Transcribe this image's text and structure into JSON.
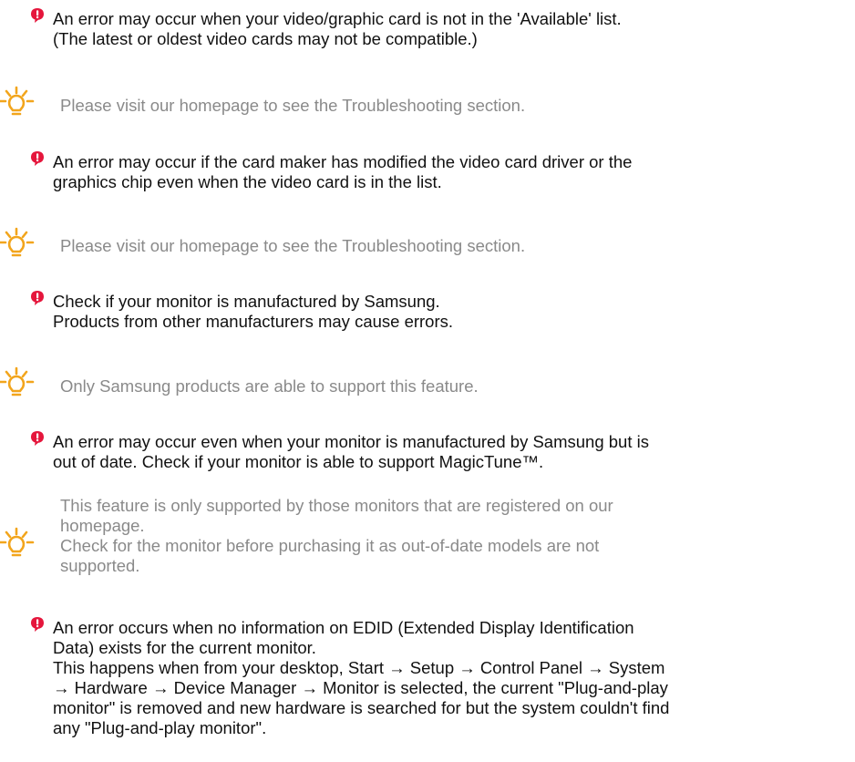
{
  "entries": [
    {
      "type": "error",
      "lines": [
        "An error may occur when your video/graphic card is not in the 'Available' list.",
        "(The latest or oldest video cards may not be compatible.)"
      ]
    },
    {
      "type": "tip",
      "lines": [
        "Please visit our homepage to see the Troubleshooting section."
      ]
    },
    {
      "type": "error",
      "lines": [
        "An error may occur if the card maker has modified the video card driver or the",
        "graphics chip even when the video card is in the list."
      ]
    },
    {
      "type": "tip",
      "lines": [
        "Please visit our homepage to see the Troubleshooting section."
      ]
    },
    {
      "type": "error",
      "lines": [
        "Check if your monitor is manufactured by Samsung.",
        "Products from other manufacturers may cause errors."
      ]
    },
    {
      "type": "tip",
      "lines": [
        "Only Samsung products are able to support this feature."
      ]
    },
    {
      "type": "error",
      "lines": [
        "An error may occur even when your monitor is manufactured by Samsung but is",
        "out of date. Check if your monitor is able to support MagicTune™."
      ]
    },
    {
      "type": "tip",
      "lines": [
        "This feature is only supported by those monitors that are registered on our",
        "homepage.",
        "Check for the monitor before purchasing it as out-of-date models are not",
        "supported."
      ]
    },
    {
      "type": "error",
      "lines": [
        "An error occurs when no information on EDID (Extended Display Identification",
        "Data) exists for the current monitor.",
        "This happens when from your desktop, Start → Setup → Control Panel → System",
        "→ Hardware → Device Manager → Monitor is selected, the current \"Plug-and-play",
        "monitor\" is removed and new hardware is searched for but the system couldn't find",
        "any \"Plug-and-play monitor\"."
      ]
    }
  ],
  "icons": {
    "error": "error-icon",
    "tip": "lightbulb-tip-icon"
  },
  "colors": {
    "error_icon": "#e5163c",
    "tip_icon": "#f2a51c",
    "error_text": "#111111",
    "tip_text": "#8a8a8a"
  }
}
